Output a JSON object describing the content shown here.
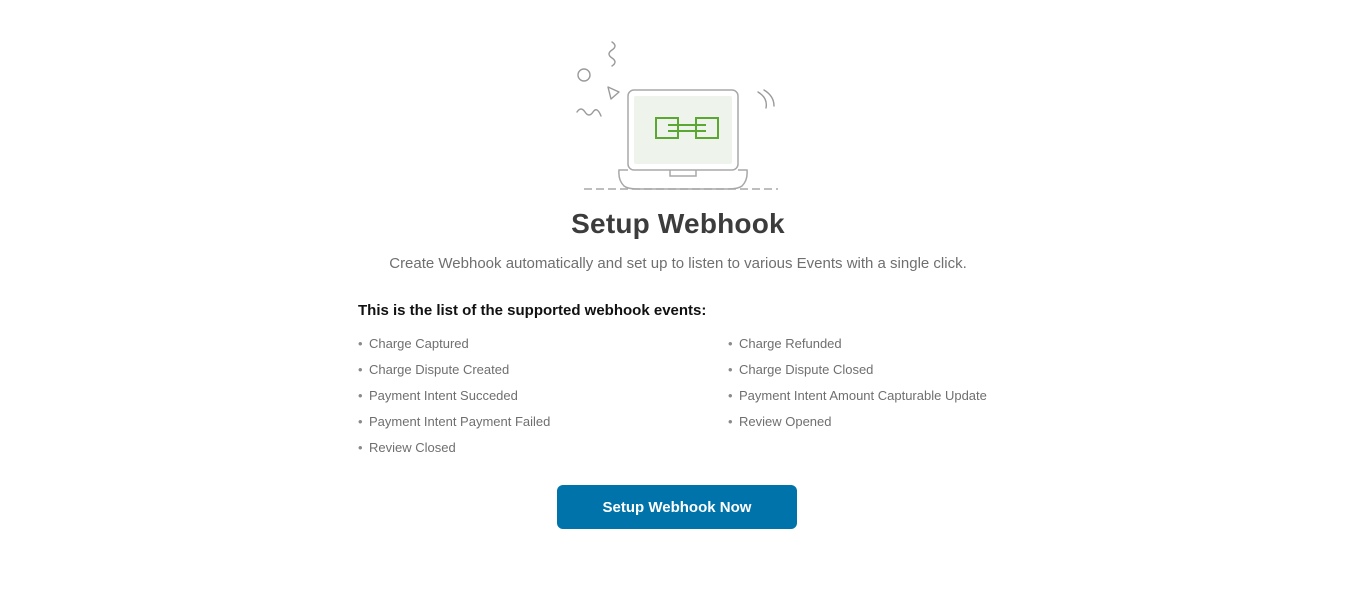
{
  "header": {
    "title": "Setup Webhook",
    "subtitle": "Create Webhook automatically and set up to listen to various Events with a single click."
  },
  "events": {
    "heading": "This is the list of the supported webhook events:",
    "left": [
      "Charge Captured",
      "Charge Dispute Created",
      "Payment Intent Succeded",
      "Payment Intent Payment Failed",
      "Review Closed"
    ],
    "right": [
      "Charge Refunded",
      "Charge Dispute Closed",
      "Payment Intent Amount Capturable Update",
      "Review Opened"
    ]
  },
  "actions": {
    "setup_label": "Setup Webhook Now"
  },
  "colors": {
    "accent": "#0073aa",
    "illustration_green": "#5aa832",
    "illustration_screen": "#eef4ec"
  },
  "icons": {
    "illustration": "laptop-webhook-icon"
  }
}
